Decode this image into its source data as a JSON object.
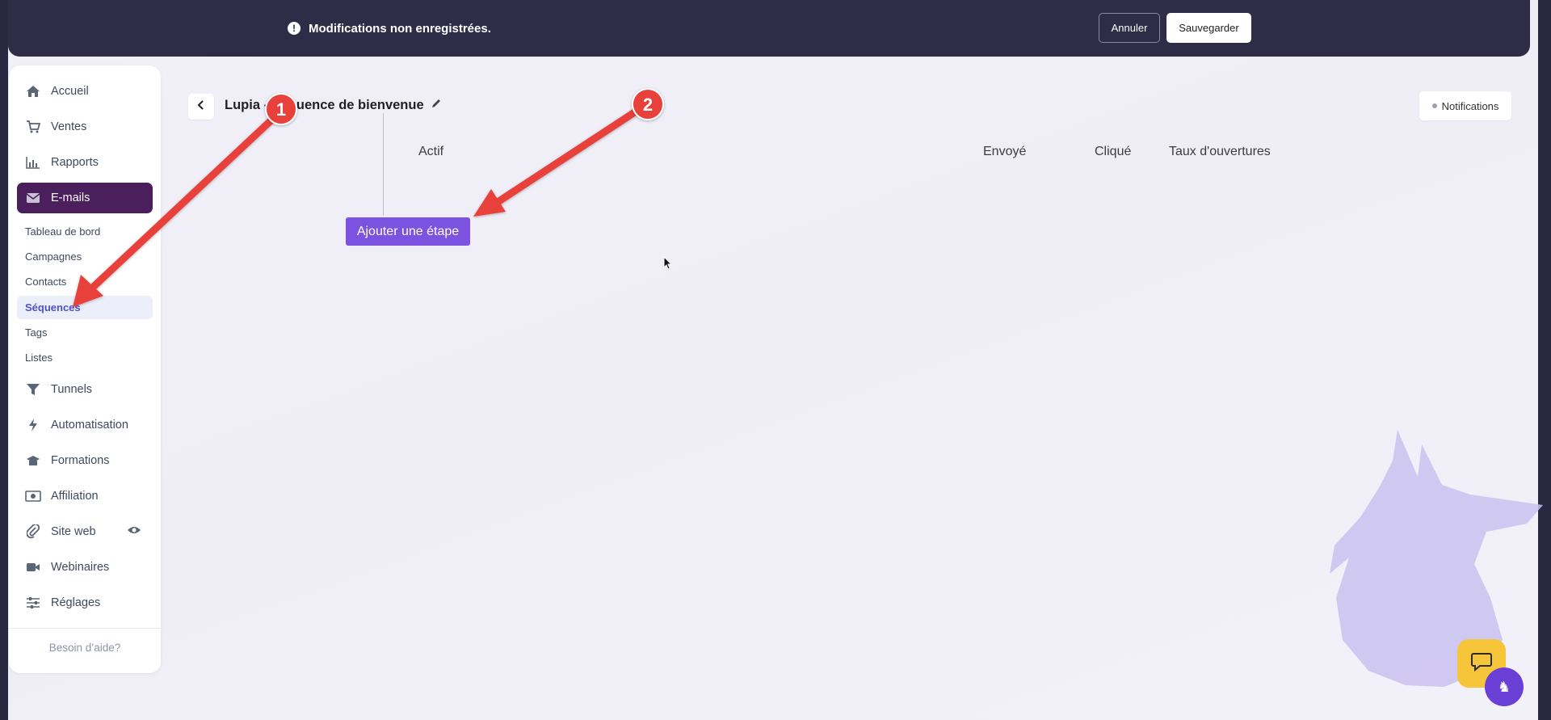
{
  "topbar": {
    "message": "Modifications non enregistrées.",
    "cancel_label": "Annuler",
    "save_label": "Sauvegarder"
  },
  "sidebar": {
    "items": [
      {
        "label": "Accueil",
        "icon": "home-icon"
      },
      {
        "label": "Ventes",
        "icon": "cart-icon"
      },
      {
        "label": "Rapports",
        "icon": "bar-chart-icon"
      },
      {
        "label": "E-mails",
        "icon": "envelope-icon",
        "active": true
      },
      {
        "label": "Tunnels",
        "icon": "funnel-icon"
      },
      {
        "label": "Automatisation",
        "icon": "bolt-icon"
      },
      {
        "label": "Formations",
        "icon": "graduation-cap-icon"
      },
      {
        "label": "Affiliation",
        "icon": "money-bill-icon"
      },
      {
        "label": "Site web",
        "icon": "paperclip-icon"
      },
      {
        "label": "Webinaires",
        "icon": "video-camera-icon"
      },
      {
        "label": "Réglages",
        "icon": "sliders-icon"
      }
    ],
    "email_subitems": [
      {
        "label": "Tableau de bord"
      },
      {
        "label": "Campagnes"
      },
      {
        "label": "Contacts"
      },
      {
        "label": "Séquences",
        "active": true
      },
      {
        "label": "Tags"
      },
      {
        "label": "Listes"
      }
    ],
    "help_label": "Besoin d’aide?"
  },
  "main": {
    "sequence_title": "Lupia - Séquence de bienvenue",
    "notifications_label": "Notifications",
    "columns": {
      "active": "Actif",
      "sent": "Envoyé",
      "clicked": "Cliqué",
      "open_rate": "Taux d'ouvertures"
    },
    "add_step_label": "Ajouter une étape"
  },
  "annotations": [
    {
      "number": "1"
    },
    {
      "number": "2"
    }
  ],
  "colors": {
    "topbar_bg": "#2e2c47",
    "active_nav_bg": "#4a1f5c",
    "active_subitem_text": "#4b52c8",
    "primary_button": "#7c52e0",
    "annotation_red": "#e8413b",
    "chat_button": "#f6c53a"
  }
}
